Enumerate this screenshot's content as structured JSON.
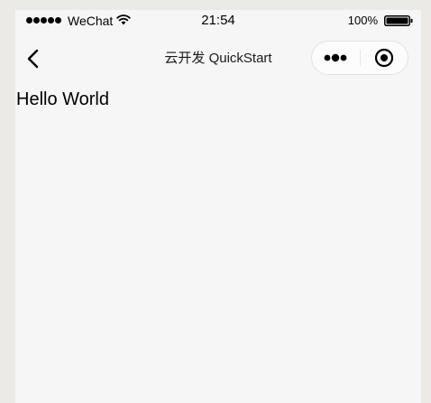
{
  "status_bar": {
    "carrier": "WeChat",
    "time": "21:54",
    "battery_percent": "100%",
    "icons": {
      "signal": "signal-dots-icon",
      "wifi": "wifi-icon",
      "battery": "battery-icon"
    }
  },
  "nav_bar": {
    "title": "云开发 QuickStart",
    "icons": {
      "back": "chevron-left-icon",
      "more": "more-dots-icon",
      "close": "target-circle-icon"
    }
  },
  "content": {
    "text": "Hello World"
  }
}
